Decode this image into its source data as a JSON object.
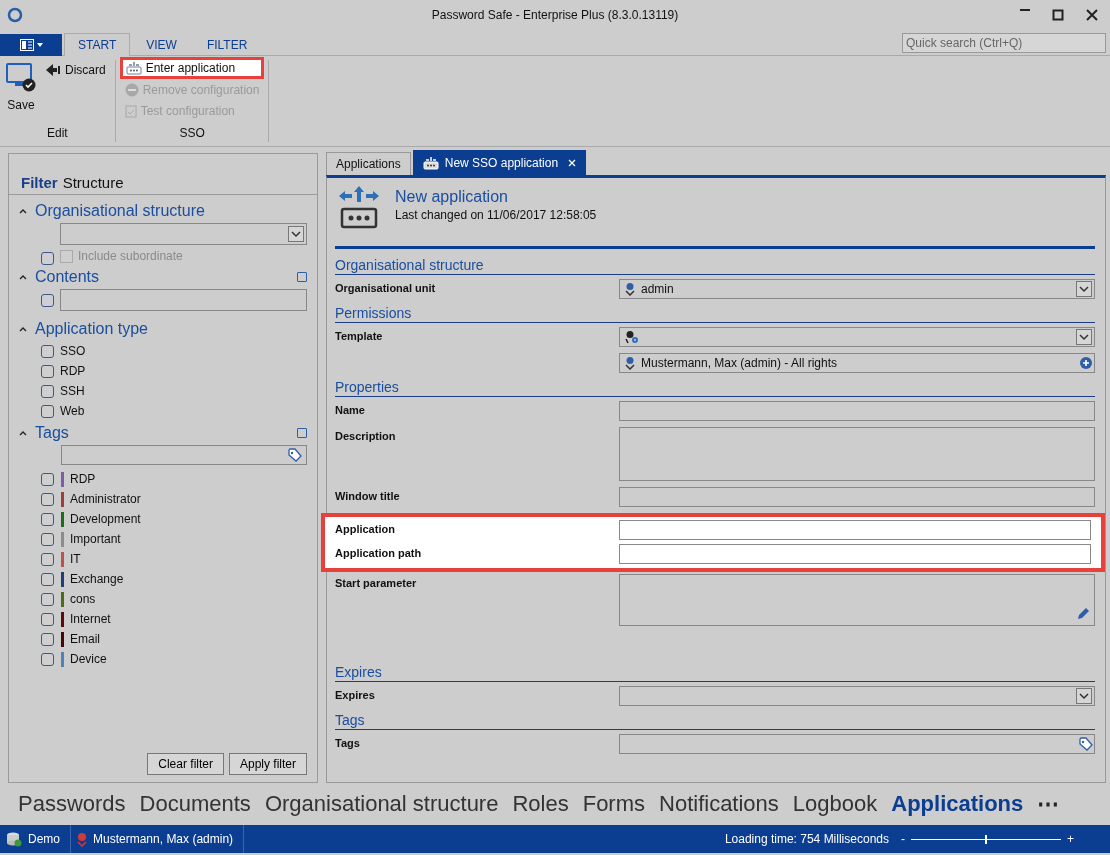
{
  "window": {
    "title": "Password Safe - Enterprise Plus (8.3.0.13119)"
  },
  "ribbon": {
    "tabs": [
      {
        "label": "START",
        "selected": true
      },
      {
        "label": "VIEW",
        "selected": false
      },
      {
        "label": "FILTER",
        "selected": false
      }
    ],
    "search": {
      "placeholder": "Quick search (Ctrl+Q)"
    },
    "groups": [
      {
        "label": "Edit",
        "buttons": [
          {
            "label": "Save",
            "kind": "large",
            "disabled": false,
            "highlighted": false
          },
          {
            "label": "Discard",
            "kind": "small",
            "disabled": false,
            "highlighted": false
          }
        ]
      },
      {
        "label": "SSO",
        "buttons": [
          {
            "label": "Enter application",
            "kind": "small",
            "disabled": false,
            "highlighted": true
          },
          {
            "label": "Remove configuration",
            "kind": "small",
            "disabled": true,
            "highlighted": false
          },
          {
            "label": "Test configuration",
            "kind": "small",
            "disabled": true,
            "highlighted": false
          }
        ]
      }
    ]
  },
  "filter": {
    "label": "Filter",
    "title": "Structure",
    "sections": [
      {
        "title": "Organisational structure",
        "kind": "org",
        "expanded": true,
        "checked": false,
        "option": {
          "label": "Include subordinate",
          "checked": false,
          "disabled": true
        }
      },
      {
        "title": "Contents",
        "kind": "text",
        "expanded": true,
        "checked": false
      },
      {
        "title": "Application type",
        "kind": "list",
        "expanded": true,
        "items": [
          {
            "label": "SSO",
            "checked": false
          },
          {
            "label": "RDP",
            "checked": false
          },
          {
            "label": "SSH",
            "checked": false
          },
          {
            "label": "Web",
            "checked": false
          }
        ]
      },
      {
        "title": "Tags",
        "kind": "tags",
        "expanded": true,
        "items": [
          {
            "label": "RDP",
            "checked": false,
            "color": "#7b5ea7"
          },
          {
            "label": "Administrator",
            "checked": false,
            "color": "#a33b3b"
          },
          {
            "label": "Development",
            "checked": false,
            "color": "#1e6b1e"
          },
          {
            "label": "Important",
            "checked": false,
            "color": "#8c8c8c"
          },
          {
            "label": "IT",
            "checked": false,
            "color": "#c0504d"
          },
          {
            "label": "Exchange",
            "checked": false,
            "color": "#1f3f7a"
          },
          {
            "label": "cons",
            "checked": false,
            "color": "#4b6b1a"
          },
          {
            "label": "Internet",
            "checked": false,
            "color": "#5c0a0a"
          },
          {
            "label": "Email",
            "checked": false,
            "color": "#4a0606"
          },
          {
            "label": "Device",
            "checked": false,
            "color": "#4f81bd"
          }
        ]
      }
    ],
    "buttons": [
      "Clear filter",
      "Apply filter"
    ]
  },
  "document": {
    "tabs": [
      {
        "label": "Applications",
        "selected": false,
        "closable": false
      },
      {
        "label": "New SSO application",
        "selected": true,
        "closable": true
      }
    ],
    "title": "New application",
    "subtitle": "Last changed on 11/06/2017 12:58:05",
    "sections": [
      {
        "title": "Organisational structure",
        "fields": [
          {
            "label": "Organisational unit",
            "kind": "dropdown",
            "value": "admin",
            "highlighted": false
          }
        ]
      },
      {
        "title": "Permissions",
        "fields": [
          {
            "label": "Template",
            "kind": "dropdown",
            "highlighted": false
          },
          {
            "kind": "entry",
            "value": "Mustermann, Max (admin) - All rights",
            "highlighted": false
          }
        ]
      },
      {
        "title": "Properties",
        "fields": [
          {
            "label": "Name",
            "kind": "text",
            "highlighted": false
          },
          {
            "label": "Description",
            "kind": "textarea",
            "highlighted": false
          },
          {
            "label": "Window title",
            "kind": "text",
            "highlighted": false
          },
          {
            "label": "Application",
            "kind": "text",
            "highlighted": true
          },
          {
            "label": "Application path",
            "kind": "text",
            "highlighted": true
          },
          {
            "label": "Start parameter",
            "kind": "editarea",
            "highlighted": false
          }
        ]
      },
      {
        "title": "Expires",
        "fields": [
          {
            "label": "Expires",
            "kind": "dropdown",
            "highlighted": false
          }
        ]
      },
      {
        "title": "Tags",
        "fields": [
          {
            "label": "Tags",
            "kind": "tags",
            "highlighted": false
          }
        ]
      }
    ]
  },
  "navigation": {
    "items": [
      {
        "label": "Passwords",
        "selected": false
      },
      {
        "label": "Documents",
        "selected": false
      },
      {
        "label": "Organisational structure",
        "selected": false
      },
      {
        "label": "Roles",
        "selected": false
      },
      {
        "label": "Forms",
        "selected": false
      },
      {
        "label": "Notifications",
        "selected": false
      },
      {
        "label": "Logbook",
        "selected": false
      },
      {
        "label": "Applications",
        "selected": true
      }
    ],
    "more": "⋯"
  },
  "status_bar": {
    "database": "Demo",
    "user": "Mustermann, Max (admin)",
    "loading": "Loading time: 754 Milliseconds",
    "zoom": {
      "minus": "-",
      "plus": "+",
      "level": 0.5
    }
  }
}
